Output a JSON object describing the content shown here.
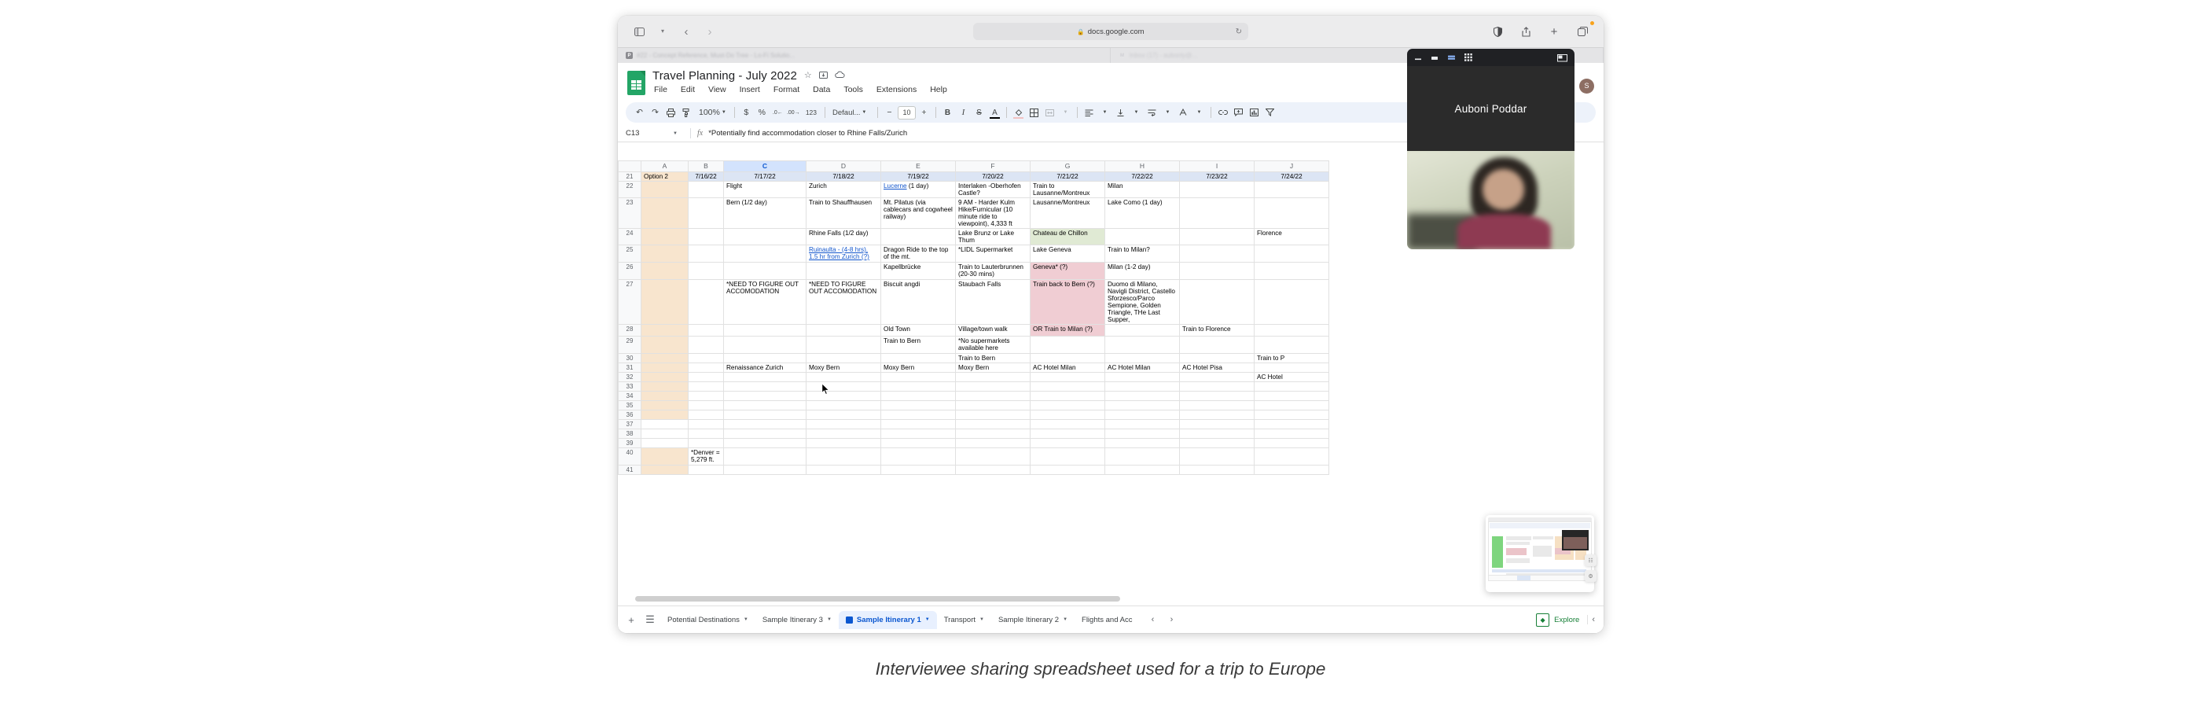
{
  "browser": {
    "url": "docs.google.com",
    "lock_icon": "lock-icon",
    "reload_icon": "reload-icon",
    "sidebar_icon": "sidebar-icon",
    "back_icon": "back-chevron-icon",
    "forward_icon": "forward-chevron-icon",
    "shield_icon": "shield-icon",
    "share_icon": "share-icon",
    "newtab_icon": "plus-icon",
    "tabs_icon": "tab-overview-icon",
    "tabs": [
      {
        "favicon": "P",
        "title": "#22 - Concept Reference, Must-Do Tree - Lo-Fi Solutio..."
      },
      {
        "favicon": "M",
        "title": "Inbox (17) - aubonly@..."
      }
    ]
  },
  "sheets": {
    "doc_title": "Travel Planning - July 2022",
    "title_icons": [
      "star-icon",
      "move-to-folder-icon",
      "cloud-saved-icon"
    ],
    "menu": [
      "File",
      "Edit",
      "View",
      "Insert",
      "Format",
      "Data",
      "Tools",
      "Extensions",
      "Help"
    ],
    "avatar_initial": "S",
    "toolbar": {
      "undo": "undo-icon",
      "redo": "redo-icon",
      "print": "print-icon",
      "paint_format": "paint-format-icon",
      "zoom": "100%",
      "currency": "$",
      "percent": "%",
      "decrease_decimal": ".0",
      "increase_decimal": ".00",
      "more_formats": "123",
      "font": "Defaul...",
      "font_size_decrease": "−",
      "font_size": "10",
      "font_size_increase": "+",
      "bold": "B",
      "italic": "I",
      "strikethrough": "S",
      "text_color": "A",
      "fill_color": "fill-color-icon",
      "borders": "borders-icon",
      "merge": "merge-cells-icon",
      "h_align": "horizontal-align-icon",
      "v_align": "vertical-align-icon",
      "text_wrap": "text-wrap-icon",
      "text_rotation": "text-rotation-icon",
      "insert_link": "link-icon",
      "insert_comment": "comment-icon",
      "insert_chart": "chart-icon",
      "filter": "filter-icon"
    },
    "formula_bar": {
      "cell_ref": "C13",
      "fx_label": "fx",
      "value": "*Potentially find accommodation closer to Rhine Falls/Zurich"
    },
    "grid": {
      "columns": [
        "A",
        "B",
        "C",
        "D",
        "E",
        "F",
        "G",
        "H",
        "I",
        "J"
      ],
      "selected_column": "C",
      "rows": [
        "21",
        "22",
        "23",
        "24",
        "25",
        "26",
        "27",
        "28",
        "29",
        "30",
        "31",
        "32",
        "33",
        "34",
        "35",
        "36",
        "37",
        "38",
        "39",
        "40",
        "41"
      ],
      "cells": {
        "21": [
          "Option 2",
          "7/16/22",
          "7/17/22",
          "7/18/22",
          "7/19/22",
          "7/20/22",
          "7/21/22",
          "7/22/22",
          "7/23/22",
          "7/24/22"
        ],
        "22": [
          "",
          "",
          "Flight",
          "Zurich",
          "Lucerne (1 day)",
          "Interlaken -Oberhofen Castle?",
          "Train to Lausanne/Montreux",
          "Milan",
          "",
          ""
        ],
        "23": [
          "",
          "",
          "Bern (1/2 day)",
          "Train to Shauffhausen",
          "Mt. Pilatus (via cablecars and cogwheel railway)",
          "9 AM - Harder Kulm Hike/Furnicular (10 minute ride to viewpoint), 4,333 ft",
          "Lausanne/Montreux",
          "Lake Como (1 day)",
          "",
          ""
        ],
        "24": [
          "",
          "",
          "",
          "Rhine Falls (1/2 day)",
          "",
          "Lake Brunz or Lake Thum",
          "Chateau de Chillon",
          "",
          "",
          "Florence"
        ],
        "25": [
          "",
          "",
          "",
          "Ruinaulta - (4-8 hrs), 1.5 hr from Zurich (?)",
          "Dragon Ride to the top of the mt.",
          "*LIDL Supermarket",
          "Lake Geneva",
          "Train to Milan?",
          "",
          ""
        ],
        "26": [
          "",
          "",
          "",
          "",
          "Kapellbrücke",
          "Train to Lauterbrunnen (20-30 mins)",
          "Geneva* (?)",
          "Milan (1-2 day)",
          "",
          ""
        ],
        "27": [
          "",
          "",
          "*NEED TO FIGURE OUT ACCOMODATION",
          "*NEED TO FIGURE OUT ACCOMODATION",
          "Biscuit angdi",
          "Staubach Falls",
          "Train back to Bern (?)",
          "Duomo di Milano, Navigli District, Castello Sforzesco/Parco Sempione, Golden Triangle, THe Last Supper,",
          "",
          ""
        ],
        "28": [
          "",
          "",
          "",
          "",
          "Old Town",
          "Village/town walk",
          "OR Train to Milan (?)",
          "",
          "Train to Florence",
          ""
        ],
        "29": [
          "",
          "",
          "",
          "",
          "Train to Bern",
          "*No supermarkets available here",
          "",
          "",
          "",
          ""
        ],
        "30": [
          "",
          "",
          "",
          "",
          "",
          "Train to Bern",
          "",
          "",
          "",
          "Train to P"
        ],
        "31": [
          "",
          "",
          "Renaissance Zurich",
          "Moxy Bern",
          "Moxy Bern",
          "Moxy Bern",
          "AC Hotel Milan",
          "AC Hotel Milan",
          "AC Hotel Pisa",
          ""
        ],
        "32": [
          "",
          "",
          "",
          "",
          "",
          "",
          "",
          "",
          "",
          "AC Hotel"
        ],
        "33": [
          "",
          "",
          "",
          "",
          "",
          "",
          "",
          "",
          "",
          ""
        ],
        "34": [
          "",
          "",
          "",
          "",
          "",
          "",
          "",
          "",
          "",
          ""
        ],
        "35": [
          "",
          "",
          "",
          "",
          "",
          "",
          "",
          "",
          "",
          ""
        ],
        "36": [
          "",
          "",
          "",
          "",
          "",
          "",
          "",
          "",
          "",
          ""
        ],
        "37": [
          "",
          "",
          "",
          "",
          "",
          "",
          "",
          "",
          "",
          ""
        ],
        "38": [
          "",
          "",
          "",
          "",
          "",
          "",
          "",
          "",
          "",
          ""
        ],
        "39": [
          "",
          "",
          "",
          "",
          "",
          "",
          "",
          "",
          "",
          ""
        ],
        "40": [
          "",
          "*Denver = 5,279 ft.",
          "",
          "",
          "",
          "",
          "",
          "",
          "",
          ""
        ],
        "41": [
          "",
          "",
          "",
          "",
          "",
          "",
          "",
          "",
          "",
          ""
        ]
      }
    },
    "sheet_tabs": {
      "add_icon": "add-sheet-icon",
      "all_sheets_icon": "all-sheets-icon",
      "items": [
        {
          "label": "Potential Destinations",
          "active": false
        },
        {
          "label": "Sample Itinerary 3",
          "active": false
        },
        {
          "label": "Sample Itinerary 1",
          "active": true
        },
        {
          "label": "Transport",
          "active": false
        },
        {
          "label": "Sample Itinerary 2",
          "active": false
        },
        {
          "label": "Flights and Acc",
          "active": false
        }
      ],
      "prev_icon": "prev-chevron-icon",
      "next_icon": "next-chevron-icon",
      "explore_label": "Explore",
      "explore_icon": "explore-icon",
      "collapse_icon": "collapse-chevron-icon"
    }
  },
  "video_call": {
    "participant_name": "Auboni Poddar",
    "minimize_icon": "minimize-icon",
    "speaker_view_icon": "speaker-view-icon",
    "split_view_icon": "split-view-icon",
    "grid_view_icon": "grid-view-icon",
    "pip_icon": "picture-in-picture-icon"
  },
  "caption": "Interviewee sharing spreadsheet used for a trip to Europe",
  "colors": {
    "accent_blue": "#0b57d0",
    "sheets_green": "#23a566",
    "tan_fill": "#f8e5ce",
    "pink_fill": "#f0cdd3",
    "green_fill": "#e0ead4",
    "date_header_fill": "#dce5f4",
    "link_blue": "#1155cc"
  }
}
